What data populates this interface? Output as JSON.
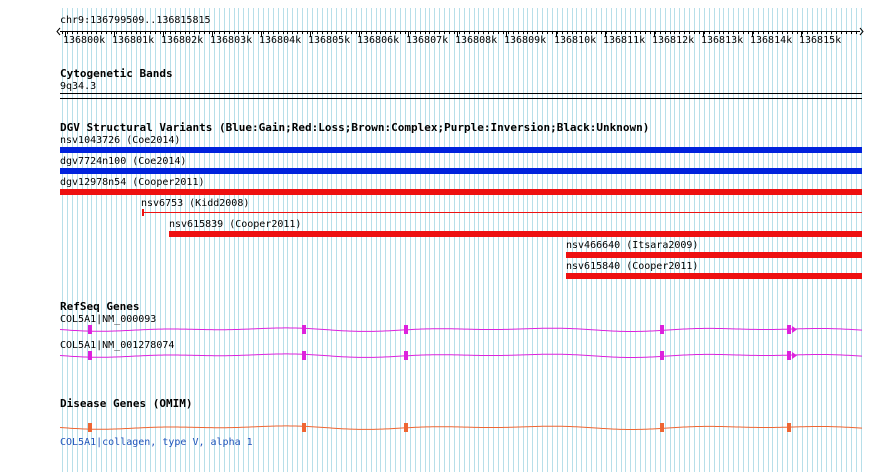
{
  "ruler": {
    "location": "chr9:136799509..136815815",
    "ticks": [
      "136800k",
      "136801k",
      "136802k",
      "136803k",
      "136804k",
      "136805k",
      "136806k",
      "136807k",
      "136808k",
      "136809k",
      "136810k",
      "136811k",
      "136812k",
      "136813k",
      "136814k",
      "136815k"
    ]
  },
  "cytobands": {
    "title": "Cytogenetic Bands",
    "band": "9q34.3"
  },
  "dgv": {
    "title": "DGV Structural Variants (Blue:Gain;Red:Loss;Brown:Complex;Purple:Inversion;Black:Unknown)",
    "colors": {
      "gain": "#0022dd",
      "loss": "#ee1111"
    },
    "variants": [
      {
        "label": "nsv1043726 (Coe2014)",
        "type": "gain"
      },
      {
        "label": "dgv7724n100 (Coe2014)",
        "type": "gain"
      },
      {
        "label": "dgv12978n54 (Cooper2011)",
        "type": "loss"
      },
      {
        "label": "nsv6753 (Kidd2008)",
        "type": "loss"
      },
      {
        "label": "nsv615839 (Cooper2011)",
        "type": "loss"
      },
      {
        "label": "nsv466640 (Itsara2009)",
        "type": "loss"
      },
      {
        "label": "nsv615840 (Cooper2011)",
        "type": "loss"
      }
    ]
  },
  "refseq": {
    "title": "RefSeq Genes",
    "color": "#dd22dd",
    "genes": [
      {
        "label": "COL5A1|NM_000093"
      },
      {
        "label": "COL5A1|NM_001278074"
      }
    ]
  },
  "omim": {
    "title": "Disease Genes (OMIM)",
    "color": "#ee6633",
    "label": "COL5A1|collagen, type V, alpha 1"
  }
}
